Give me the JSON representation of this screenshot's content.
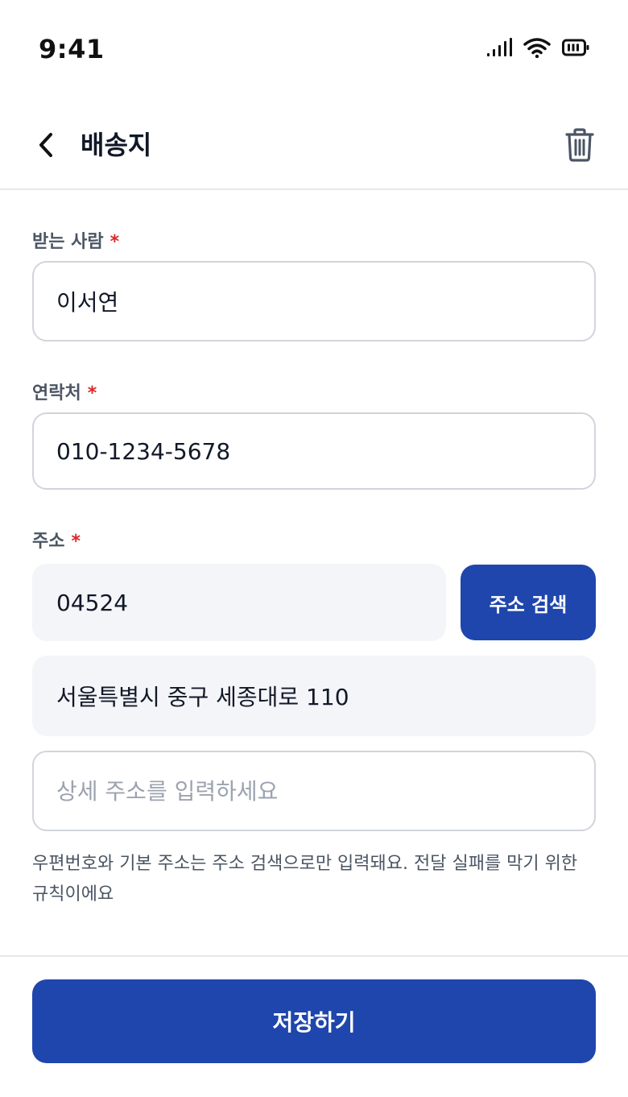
{
  "status_bar": {
    "time": "9:41",
    "icons": [
      "signal-icon",
      "wifi-icon",
      "battery-icon"
    ]
  },
  "header": {
    "title": "배송지",
    "back_icon": "chevron-left-icon",
    "delete_icon": "trash-icon"
  },
  "form": {
    "recipient": {
      "label": "받는 사람",
      "required_mark": "*",
      "value": "이서연"
    },
    "phone": {
      "label": "연락처",
      "required_mark": "*",
      "value": "010-1234-5678"
    },
    "address": {
      "label": "주소",
      "required_mark": "*",
      "postcode": "04524",
      "search_button": "주소 검색",
      "base_address": "서울특별시 중구 세종대로 110",
      "detail_value": "",
      "detail_placeholder": "상세 주소를 입력하세요"
    },
    "helper_text": "우편번호와 기본 주소는 주소 검색으로만 입력돼요. 전달 실패를 막기 위한 규칙이에요"
  },
  "footer": {
    "save_label": "저장하기"
  },
  "colors": {
    "primary": "#1f46ad",
    "required": "#dc2626",
    "readonly_bg": "#f4f5f9"
  }
}
